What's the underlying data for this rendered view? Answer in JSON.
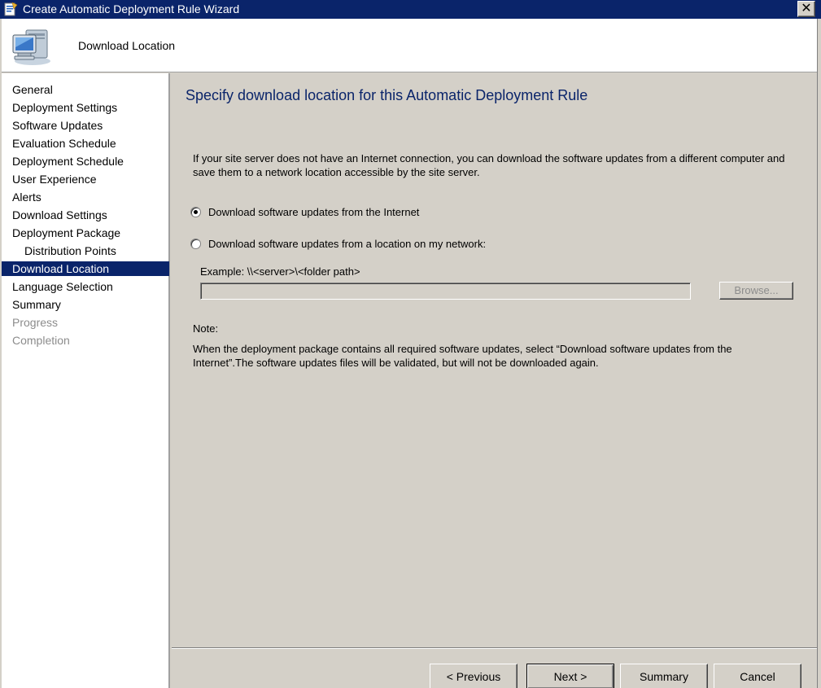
{
  "window": {
    "title": "Create Automatic Deployment Rule Wizard",
    "close_label": "✕"
  },
  "header": {
    "title": "Download Location",
    "icon": "computer-icon"
  },
  "sidebar": {
    "items": [
      {
        "label": "General",
        "state": "normal"
      },
      {
        "label": "Deployment Settings",
        "state": "normal"
      },
      {
        "label": "Software Updates",
        "state": "normal"
      },
      {
        "label": "Evaluation Schedule",
        "state": "normal"
      },
      {
        "label": "Deployment Schedule",
        "state": "normal"
      },
      {
        "label": "User Experience",
        "state": "normal"
      },
      {
        "label": "Alerts",
        "state": "normal"
      },
      {
        "label": "Download Settings",
        "state": "normal"
      },
      {
        "label": "Deployment Package",
        "state": "normal"
      },
      {
        "label": "Distribution Points",
        "state": "sub"
      },
      {
        "label": "Download Location",
        "state": "active"
      },
      {
        "label": "Language Selection",
        "state": "normal"
      },
      {
        "label": "Summary",
        "state": "normal"
      },
      {
        "label": "Progress",
        "state": "disabled"
      },
      {
        "label": "Completion",
        "state": "disabled"
      }
    ]
  },
  "main": {
    "heading": "Specify download location for this Automatic Deployment Rule",
    "intro": "If your site server does not have an Internet connection, you can download the software updates from a different computer and save them to a network location accessible by the site server.",
    "option_internet": {
      "label": "Download software updates from the Internet",
      "checked": true
    },
    "option_network": {
      "label": "Download software updates from a location on my network:",
      "checked": false
    },
    "example_label": "Example: \\\\<server>\\<folder path>",
    "path_value": "",
    "browse_label": "Browse...",
    "note_label": "Note:",
    "note_text": "When the deployment package contains all required software updates, select “Download  software updates from the Internet”.The software updates files will be validated, but will not be downloaded again."
  },
  "footer": {
    "previous_label": "< Previous",
    "next_label": "Next >",
    "summary_label": "Summary",
    "cancel_label": "Cancel"
  },
  "colors": {
    "title_bar": "#0a246a",
    "selection": "#0a246a",
    "heading_text": "#0a246a",
    "face": "#d4d0c8"
  }
}
